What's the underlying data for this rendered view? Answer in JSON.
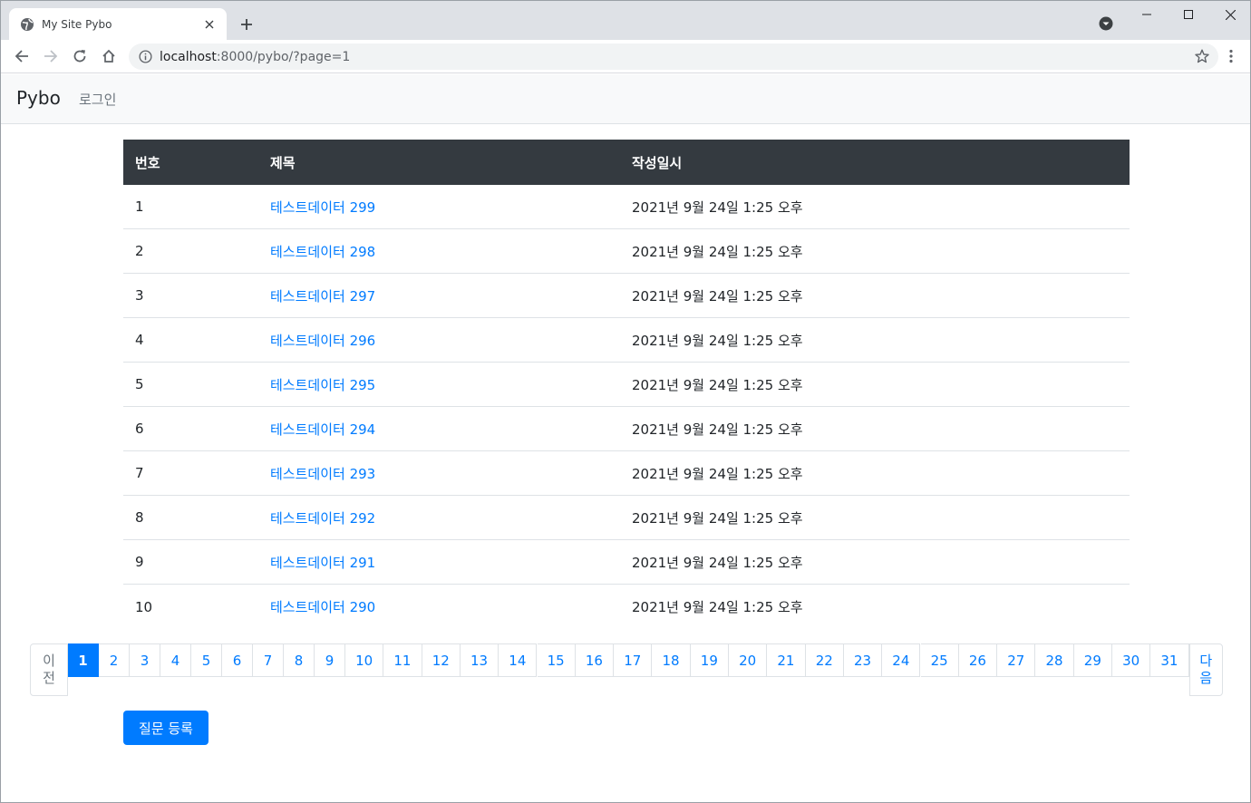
{
  "browser": {
    "tab_title": "My Site Pybo",
    "url_host": "localhost",
    "url_path": ":8000/pybo/?page=1"
  },
  "navbar": {
    "brand": "Pybo",
    "login": "로그인"
  },
  "table": {
    "headers": [
      "번호",
      "제목",
      "작성일시"
    ],
    "rows": [
      {
        "num": "1",
        "subject": "테스트데이터 299",
        "date": "2021년 9월 24일 1:25 오후"
      },
      {
        "num": "2",
        "subject": "테스트데이터 298",
        "date": "2021년 9월 24일 1:25 오후"
      },
      {
        "num": "3",
        "subject": "테스트데이터 297",
        "date": "2021년 9월 24일 1:25 오후"
      },
      {
        "num": "4",
        "subject": "테스트데이터 296",
        "date": "2021년 9월 24일 1:25 오후"
      },
      {
        "num": "5",
        "subject": "테스트데이터 295",
        "date": "2021년 9월 24일 1:25 오후"
      },
      {
        "num": "6",
        "subject": "테스트데이터 294",
        "date": "2021년 9월 24일 1:25 오후"
      },
      {
        "num": "7",
        "subject": "테스트데이터 293",
        "date": "2021년 9월 24일 1:25 오후"
      },
      {
        "num": "8",
        "subject": "테스트데이터 292",
        "date": "2021년 9월 24일 1:25 오후"
      },
      {
        "num": "9",
        "subject": "테스트데이터 291",
        "date": "2021년 9월 24일 1:25 오후"
      },
      {
        "num": "10",
        "subject": "테스트데이터 290",
        "date": "2021년 9월 24일 1:25 오후"
      }
    ]
  },
  "pagination": {
    "prev_line1": "이",
    "prev_line2": "전",
    "next_line1": "다",
    "next_line2": "음",
    "pages": [
      "1",
      "2",
      "3",
      "4",
      "5",
      "6",
      "7",
      "8",
      "9",
      "10",
      "11",
      "12",
      "13",
      "14",
      "15",
      "16",
      "17",
      "18",
      "19",
      "20",
      "21",
      "22",
      "23",
      "24",
      "25",
      "26",
      "27",
      "28",
      "29",
      "30",
      "31"
    ],
    "active_page": "1"
  },
  "ask_button": "질문 등록",
  "colors": {
    "primary": "#007bff",
    "table_header": "#343a40",
    "navbar_bg": "#f8f9fa"
  }
}
